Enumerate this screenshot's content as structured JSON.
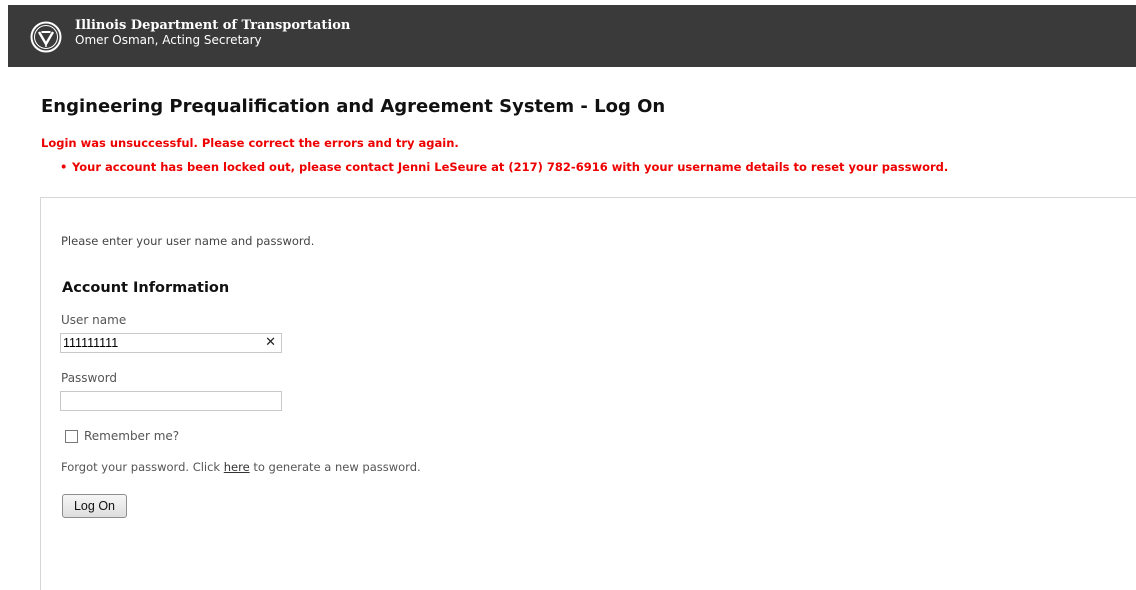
{
  "header": {
    "agency_name": "Illinois Department of Transportation",
    "secretary": "Omer Osman, Acting Secretary",
    "logo_icon": "idot-logo-icon",
    "background_color": "#3a3a3a"
  },
  "page": {
    "title": "Engineering Prequalification and Agreement System - Log On"
  },
  "errors": {
    "summary": "Login was unsuccessful. Please correct the errors and try again.",
    "items": [
      "Your account has been locked out, please contact Jenni LeSeure at (217) 782-6916 with your username details to reset your password."
    ],
    "color": "#ee0000"
  },
  "form": {
    "intro": "Please enter your user name and password.",
    "section_title": "Account Information",
    "username_label": "User name",
    "username_value": "111111111",
    "clear_icon": "clear-icon",
    "password_label": "Password",
    "password_value": "",
    "remember_label": "Remember me?",
    "remember_checked": false,
    "forgot_prefix": "Forgot your password. Click ",
    "forgot_link": "here",
    "forgot_suffix": " to generate a new password.",
    "submit_label": "Log On"
  }
}
